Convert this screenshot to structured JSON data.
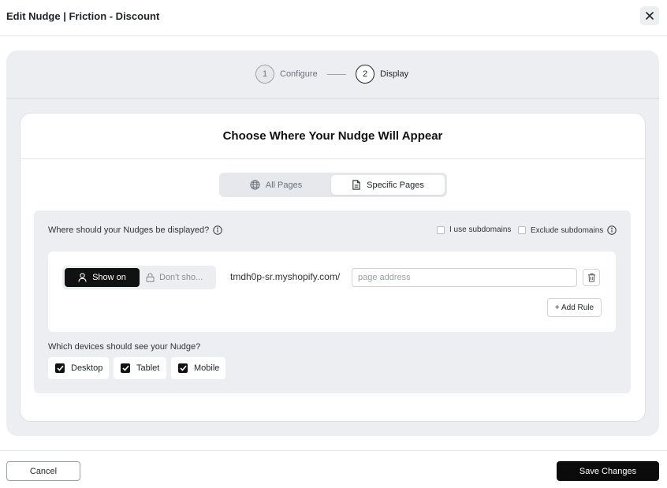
{
  "header": {
    "title": "Edit Nudge | Friction - Discount",
    "close_icon": "close-icon"
  },
  "stepper": {
    "steps": [
      {
        "number": "1",
        "label": "Configure",
        "state": "completed"
      },
      {
        "number": "2",
        "label": "Display",
        "state": "active"
      }
    ]
  },
  "card": {
    "title": "Choose Where Your Nudge Will Appear"
  },
  "page_scope": {
    "options": [
      {
        "label": "All Pages",
        "icon": "globe-icon",
        "selected": false
      },
      {
        "label": "Specific Pages",
        "icon": "document-icon",
        "selected": true
      }
    ]
  },
  "display_rules": {
    "question": "Where should your Nudges be displayed?",
    "use_subdomains_label": "I use subdomains",
    "exclude_subdomains_label": "Exclude subdomains",
    "use_subdomains_checked": false,
    "exclude_subdomains_checked": false,
    "rule": {
      "show_on_label": "Show on",
      "dont_show_label": "Don't sho...",
      "selected_mode": "Show on",
      "domain": "tmdh0p-sr.myshopify.com/",
      "page_address_value": "",
      "page_address_placeholder": "page address"
    },
    "add_rule_label": "+ Add Rule"
  },
  "devices": {
    "question": "Which devices should see your Nudge?",
    "items": [
      {
        "label": "Desktop",
        "checked": true
      },
      {
        "label": "Tablet",
        "checked": true
      },
      {
        "label": "Mobile",
        "checked": true
      }
    ]
  },
  "footer": {
    "cancel_label": "Cancel",
    "save_label": "Save Changes"
  },
  "colors": {
    "accent": "#0b0b0b",
    "panel_bg": "#eceef1",
    "card_bg": "#ffffff",
    "muted_text": "#6b7280"
  }
}
